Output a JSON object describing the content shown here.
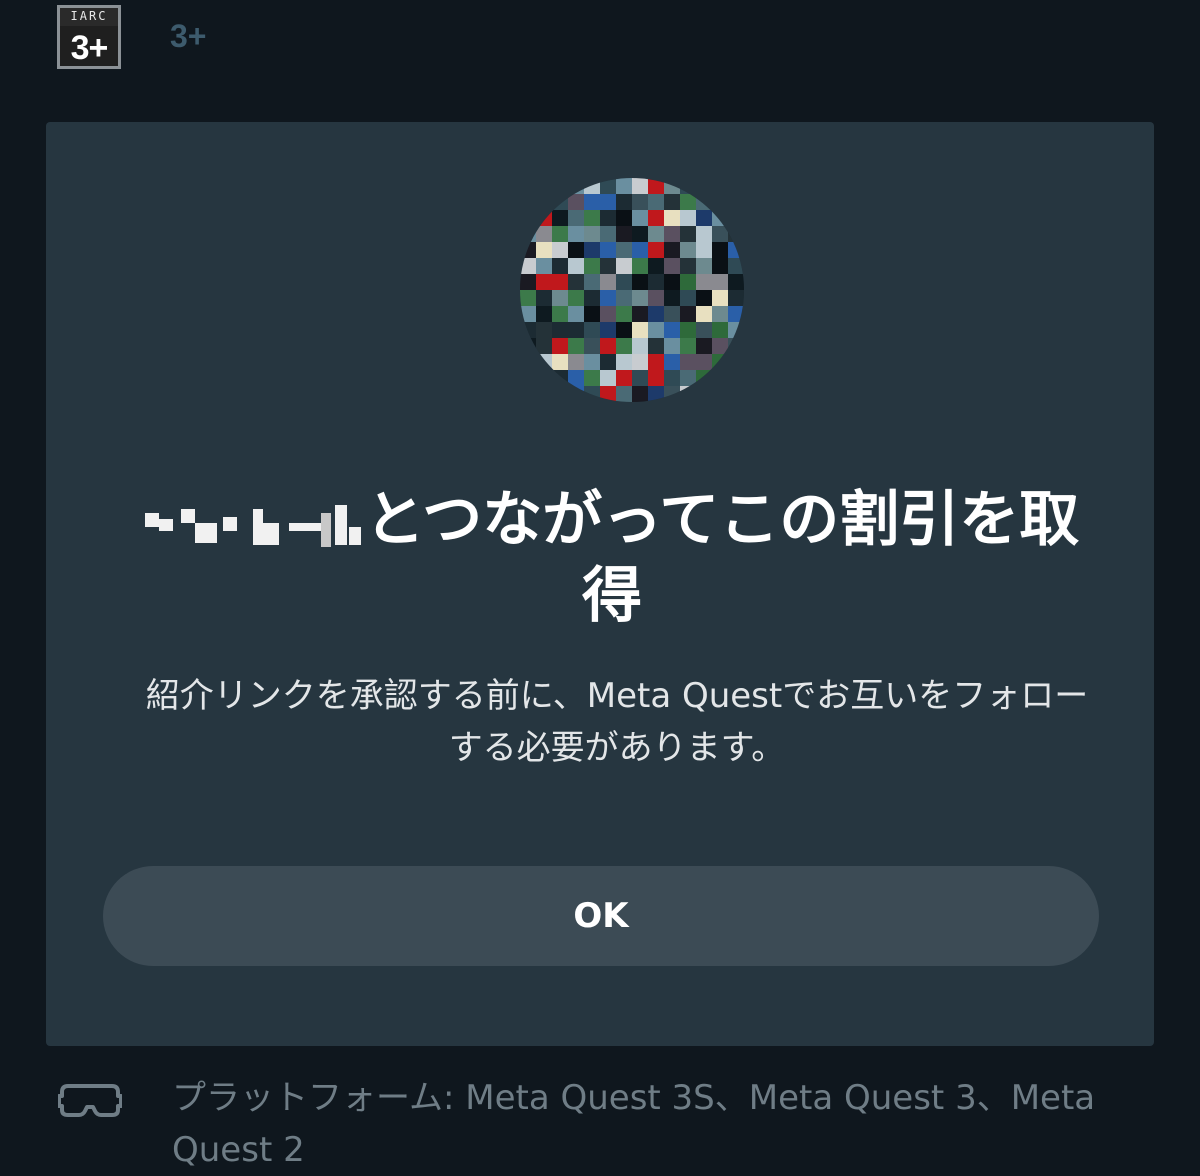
{
  "rating": {
    "badge_top": "IARC",
    "badge_value": "3+",
    "label": "3+"
  },
  "dialog": {
    "title_suffix": "とつながってこの割引を取得",
    "description": "紹介リンクを承認する前に、Meta Questでお互いをフォローする必要があります。",
    "ok_label": "OK"
  },
  "platform": {
    "icon": "vr-headset-icon",
    "text": "プラットフォーム: Meta Quest 3S、Meta Quest 3、Meta Quest 2"
  },
  "colors": {
    "background": "#0f171e",
    "dialog": "#263640",
    "button": "#3c4b55",
    "rating_accent": "#3d5b6d"
  }
}
